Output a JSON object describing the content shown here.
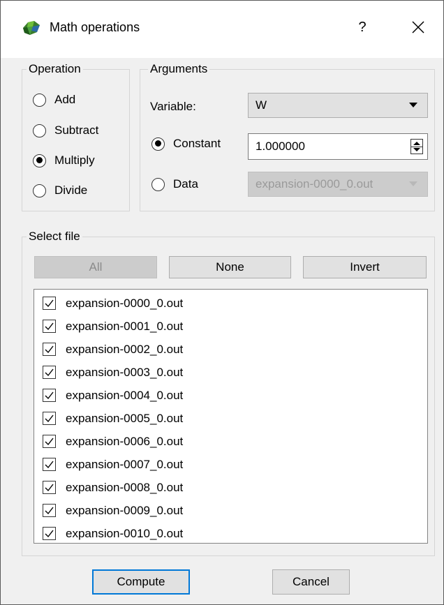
{
  "window": {
    "title": "Math operations",
    "help_label": "?",
    "close_icon": "close-icon"
  },
  "operation": {
    "title": "Operation",
    "options": [
      {
        "label": "Add",
        "checked": false
      },
      {
        "label": "Subtract",
        "checked": false
      },
      {
        "label": "Multiply",
        "checked": true
      },
      {
        "label": "Divide",
        "checked": false
      }
    ]
  },
  "arguments": {
    "title": "Arguments",
    "variable_label": "Variable:",
    "variable_value": "W",
    "constant_label": "Constant",
    "constant_checked": true,
    "constant_value": "1.000000",
    "data_label": "Data",
    "data_checked": false,
    "data_value": "expansion-0000_0.out"
  },
  "select_file": {
    "title": "Select file",
    "all_label": "All",
    "none_label": "None",
    "invert_label": "Invert",
    "files": [
      {
        "name": "expansion-0000_0.out",
        "checked": true
      },
      {
        "name": "expansion-0001_0.out",
        "checked": true
      },
      {
        "name": "expansion-0002_0.out",
        "checked": true
      },
      {
        "name": "expansion-0003_0.out",
        "checked": true
      },
      {
        "name": "expansion-0004_0.out",
        "checked": true
      },
      {
        "name": "expansion-0005_0.out",
        "checked": true
      },
      {
        "name": "expansion-0006_0.out",
        "checked": true
      },
      {
        "name": "expansion-0007_0.out",
        "checked": true
      },
      {
        "name": "expansion-0008_0.out",
        "checked": true
      },
      {
        "name": "expansion-0009_0.out",
        "checked": true
      },
      {
        "name": "expansion-0010_0.out",
        "checked": true
      }
    ]
  },
  "footer": {
    "compute_label": "Compute",
    "cancel_label": "Cancel"
  },
  "colors": {
    "accent": "#0078d7",
    "window_bg": "#f0f0f0",
    "titlebar_bg": "#ffffff"
  }
}
